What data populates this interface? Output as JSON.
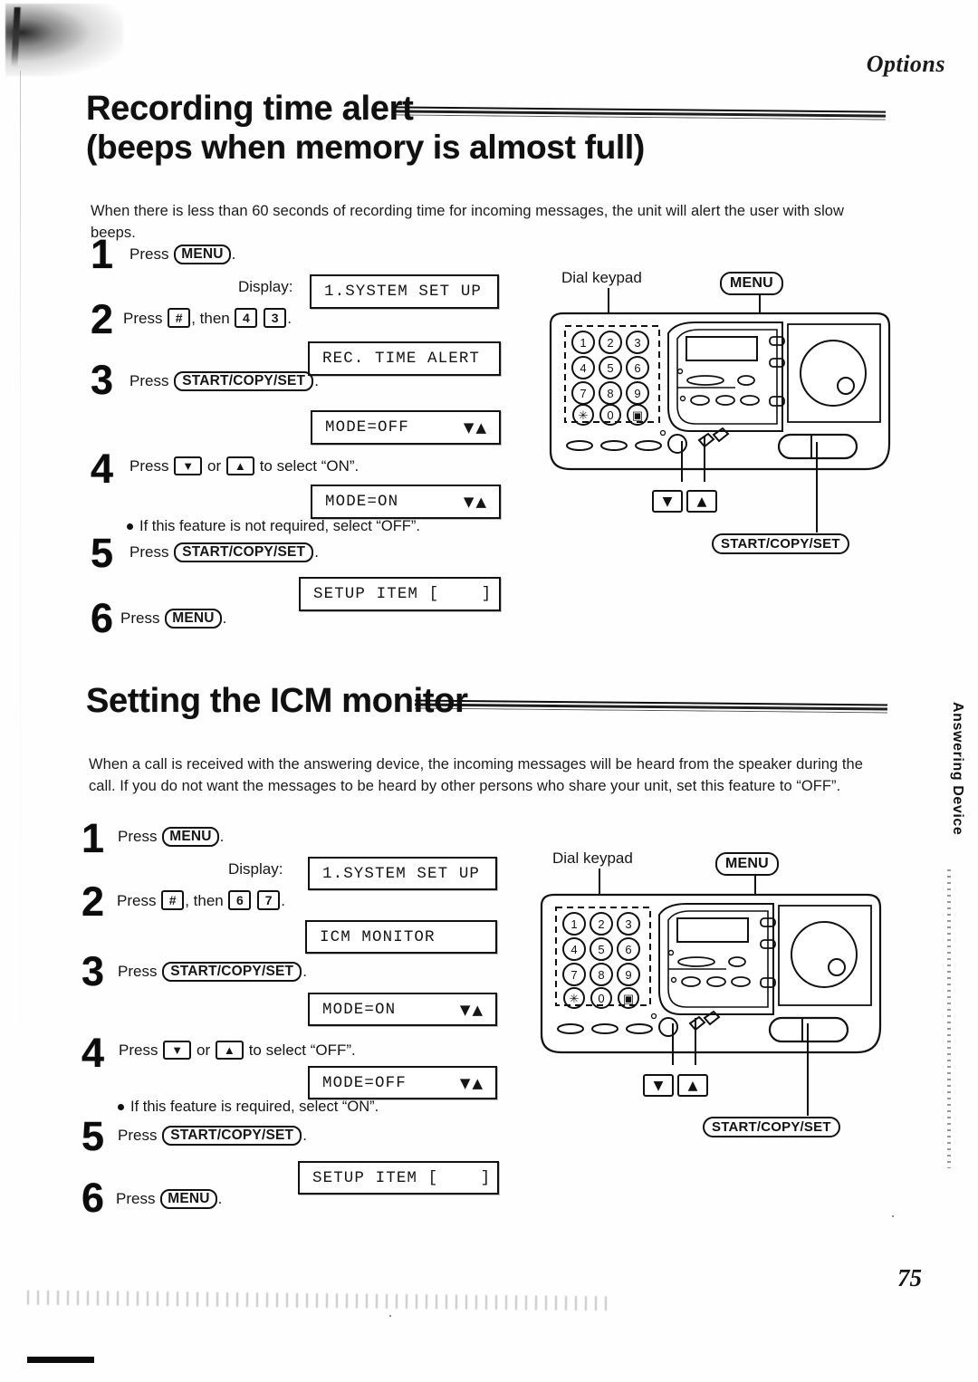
{
  "header": {
    "running_head": "Options"
  },
  "page": {
    "number": "75",
    "side_tab": "Answering Device"
  },
  "sections": [
    {
      "id": "recording-time-alert",
      "title_line1": "Recording time alert",
      "title_line2": "(beeps when memory is almost full)",
      "intro": "When there is less than 60 seconds of recording time for incoming messages, the unit will alert the user with slow beeps.",
      "display_label": "Display:",
      "steps": [
        {
          "num": "1",
          "text_pre": "Press",
          "key": "MENU",
          "text_post": "."
        },
        {
          "num": "2",
          "text_pre": "Press",
          "key": "#",
          "text_mid": ", then",
          "key2": "4",
          "key3": "3",
          "text_post": "."
        },
        {
          "num": "3",
          "text_pre": "Press",
          "key": "START/COPY/SET",
          "text_post": "."
        },
        {
          "num": "4",
          "text_pre": "Press",
          "key": "▼",
          "text_mid": "or",
          "key2": "▲",
          "text_post": "to select “ON”."
        },
        {
          "num": "5",
          "text_pre": "Press",
          "key": "START/COPY/SET",
          "text_post": "."
        },
        {
          "num": "6",
          "text_pre": "Press",
          "key": "MENU",
          "text_post": "."
        }
      ],
      "bullet": "If this feature is not required, select “OFF”.",
      "displays": [
        {
          "text": "1.SYSTEM SET UP",
          "arrows": ""
        },
        {
          "text": "REC. TIME ALERT",
          "arrows": ""
        },
        {
          "text": "MODE=OFF",
          "arrows": "▼▲"
        },
        {
          "text": "MODE=ON",
          "arrows": "▼▲"
        },
        {
          "text": "SETUP ITEM [    ]",
          "arrows": ""
        }
      ],
      "diagram": {
        "keypad_label": "Dial keypad",
        "menu_label": "MENU",
        "start_label": "START/COPY/SET",
        "down_key": "▼",
        "up_key": "▲",
        "keypad_keys": [
          "1",
          "2",
          "3",
          "4",
          "5",
          "6",
          "7",
          "8",
          "9",
          "✳",
          "0",
          "▣"
        ]
      }
    },
    {
      "id": "icm-monitor",
      "title_line1": "Setting the ICM monitor",
      "intro": "When a call is received with the answering device, the incoming messages will be heard from the speaker during the call. If you do not want the messages to be heard by other persons who share your unit, set this feature to “OFF”.",
      "display_label": "Display:",
      "steps": [
        {
          "num": "1",
          "text_pre": "Press",
          "key": "MENU",
          "text_post": "."
        },
        {
          "num": "2",
          "text_pre": "Press",
          "key": "#",
          "text_mid": ", then",
          "key2": "6",
          "key3": "7",
          "text_post": "."
        },
        {
          "num": "3",
          "text_pre": "Press",
          "key": "START/COPY/SET",
          "text_post": "."
        },
        {
          "num": "4",
          "text_pre": "Press",
          "key": "▼",
          "text_mid": "or",
          "key2": "▲",
          "text_post": "to select “OFF”."
        },
        {
          "num": "5",
          "text_pre": "Press",
          "key": "START/COPY/SET",
          "text_post": "."
        },
        {
          "num": "6",
          "text_pre": "Press",
          "key": "MENU",
          "text_post": "."
        }
      ],
      "bullet": "If this feature is required, select “ON”.",
      "displays": [
        {
          "text": "1.SYSTEM SET UP",
          "arrows": ""
        },
        {
          "text": "ICM MONITOR",
          "arrows": ""
        },
        {
          "text": "MODE=ON",
          "arrows": "▼▲"
        },
        {
          "text": "MODE=OFF",
          "arrows": "▼▲"
        },
        {
          "text": "SETUP ITEM [    ]",
          "arrows": ""
        }
      ],
      "diagram": {
        "keypad_label": "Dial keypad",
        "menu_label": "MENU",
        "start_label": "START/COPY/SET",
        "down_key": "▼",
        "up_key": "▲",
        "keypad_keys": [
          "1",
          "2",
          "3",
          "4",
          "5",
          "6",
          "7",
          "8",
          "9",
          "✳",
          "0",
          "▣"
        ]
      }
    }
  ]
}
